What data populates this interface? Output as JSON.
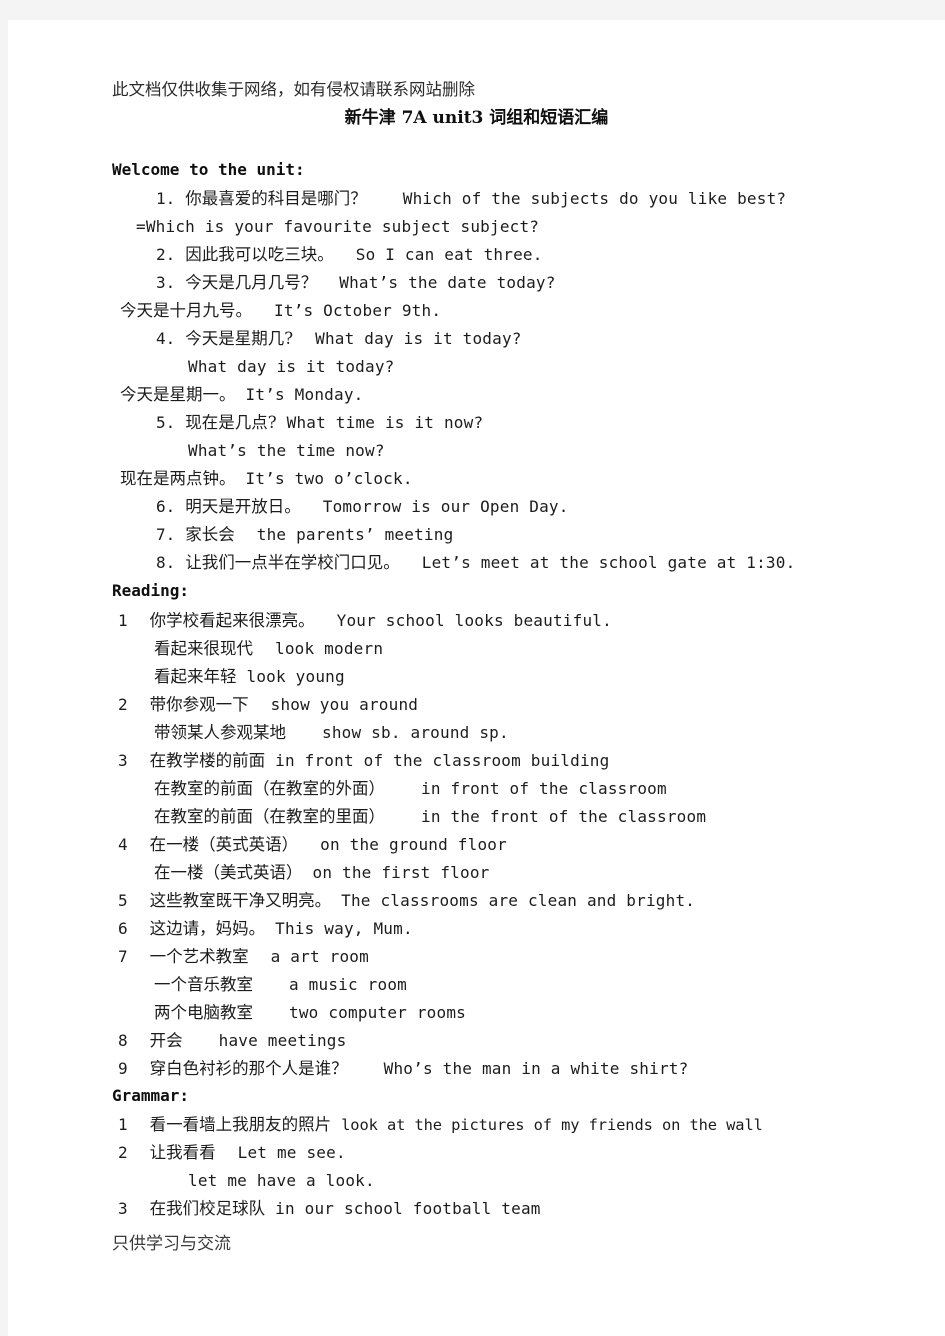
{
  "page": {
    "background": "#ffffff",
    "canvas_background": "#f4f4f4",
    "text_color": "#1c1c1c"
  },
  "watermark_top": "此文档仅供收集于网络，如有侵权请联系网站删除",
  "title": "新牛津 7A unit3 词组和短语汇编",
  "footer": "只供学习与交流",
  "sections": [
    {
      "heading": "Welcome to the unit:",
      "lines": [
        {
          "num": "1.",
          "cn": "你最喜爱的科目是哪门？",
          "en": "Which of the subjects do you like best?"
        },
        {
          "num": "",
          "cn": "",
          "en": "=Which is your favourite subject subject?"
        },
        {
          "num": "2.",
          "cn": "因此我可以吃三块。",
          "en": "So I can eat three."
        },
        {
          "num": "3.",
          "cn": "今天是几月几号？",
          "en": "What’s the date today?"
        },
        {
          "num": "",
          "cn": "今天是十月九号。",
          "en": "It’s October 9th."
        },
        {
          "num": "4.",
          "cn": "今天是星期几?",
          "en": "What day is it today?"
        },
        {
          "num": "",
          "cn": "",
          "en": "What day is it today?"
        },
        {
          "num": "",
          "cn": "今天是星期一。",
          "en": "It’s Monday."
        },
        {
          "num": "5.",
          "cn": "现在是几点?",
          "en": "What time is it now?"
        },
        {
          "num": "",
          "cn": "",
          "en": "What’s the time now?"
        },
        {
          "num": "",
          "cn": "现在是两点钟。",
          "en": "It’s two o’clock."
        },
        {
          "num": "6.",
          "cn": "明天是开放日。",
          "en": "Tomorrow is our Open Day."
        },
        {
          "num": "7.",
          "cn": "家长会",
          "en": "the parents’ meeting"
        },
        {
          "num": "8.",
          "cn": "让我们一点半在学校门口见。",
          "en": "Let’s meet at the school gate at 1:30."
        }
      ]
    },
    {
      "heading": "Reading:",
      "lines": [
        {
          "num": "1",
          "cn": "你学校看起来很漂亮。",
          "en": "Your school looks beautiful."
        },
        {
          "num": "",
          "cn": "看起来很现代",
          "en": "look modern"
        },
        {
          "num": "",
          "cn": "看起来年轻",
          "en": "look young"
        },
        {
          "num": "2",
          "cn": "带你参观一下",
          "en": "show you around"
        },
        {
          "num": "",
          "cn": "带领某人参观某地",
          "en": "show sb. around sp."
        },
        {
          "num": "3",
          "cn": "在教学楼的前面",
          "en": "in front of the classroom building"
        },
        {
          "num": "",
          "cn": "在教室的前面（在教室的外面）",
          "en": "in front of the classroom"
        },
        {
          "num": "",
          "cn": "在教室的前面（在教室的里面）",
          "en": "in the front of the classroom"
        },
        {
          "num": "4",
          "cn": "在一楼（英式英语）",
          "en": "on the ground floor"
        },
        {
          "num": "",
          "cn": "在一楼（美式英语）",
          "en": "on the first floor"
        },
        {
          "num": "5",
          "cn": "这些教室既干净又明亮。",
          "en": "The classrooms are clean and bright."
        },
        {
          "num": "6",
          "cn": "这边请，妈妈。",
          "en": "This way, Mum."
        },
        {
          "num": "7",
          "cn": "一个艺术教室",
          "en": "a art room"
        },
        {
          "num": "",
          "cn": "一个音乐教室",
          "en": "a music room"
        },
        {
          "num": "",
          "cn": "两个电脑教室",
          "en": "two computer rooms"
        },
        {
          "num": "8",
          "cn": "开会",
          "en": "have meetings"
        },
        {
          "num": "9",
          "cn": "穿白色衬衫的那个人是谁？",
          "en": "Who’s the man in a white shirt?"
        }
      ]
    },
    {
      "heading": "Grammar:",
      "lines": [
        {
          "num": "1",
          "cn": "看一看墙上我朋友的照片",
          "en": "look at the pictures of my friends on the wall"
        },
        {
          "num": "2",
          "cn": "让我看看",
          "en": "Let me see."
        },
        {
          "num": "",
          "cn": "",
          "en": "let me have a look."
        },
        {
          "num": "3",
          "cn": "在我们校足球队",
          "en": "in our school football team"
        }
      ]
    }
  ]
}
